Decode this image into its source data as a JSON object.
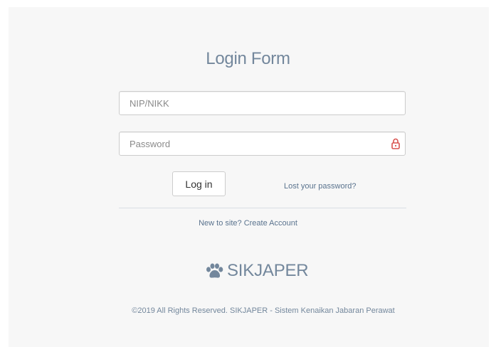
{
  "form": {
    "title": "Login Form",
    "username_placeholder": "NIP/NIKK",
    "password_placeholder": "Password",
    "login_label": "Log in",
    "lost_password_label": "Lost your password?"
  },
  "signup": {
    "prompt": "New to site?",
    "link_label": "Create Account"
  },
  "brand": {
    "icon": "paw-icon",
    "name": "SIKJAPER"
  },
  "footer": {
    "copyright": "©2019 All Rights Reserved. SIKJAPER - Sistem Kenaikan Jabaran Perawat"
  },
  "colors": {
    "background": "#f7f7f7",
    "title_text": "#73879c",
    "link_text": "#5a738e",
    "lock_icon": "#d9534f",
    "input_border": "#cccccc"
  }
}
